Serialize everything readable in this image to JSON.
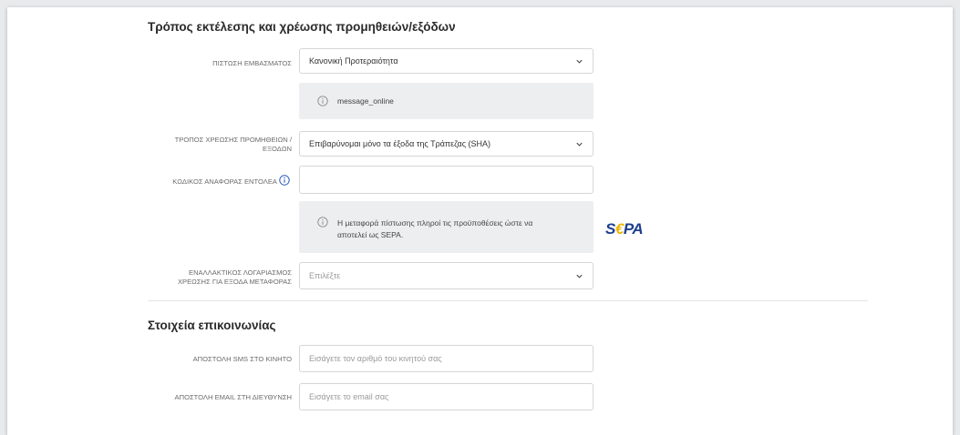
{
  "section1": {
    "title": "Τρόπος εκτέλεσης και χρέωσης προμηθειών/εξόδων",
    "credit_label": "ΠΙΣΤΩΣΗ ΕΜΒΑΣΜΑΤΟΣ",
    "credit_value": "Κανονική Προτεραιότητα",
    "message_online": "message_online",
    "charge_label_line1": "ΤΡΟΠΟΣ ΧΡΕΩΣΗΣ ΠΡΟΜΗΘΕΙΩΝ /",
    "charge_label_line2": "ΕΞΟΔΩΝ",
    "charge_value": "Επιβαρύνομαι μόνο τα έξοδα της Τράπεζας (SHA)",
    "reference_label": "ΚΩΔΙΚΟΣ ΑΝΑΦΟΡΑΣ ΕΝΤΟΛΕΑ",
    "reference_value": "",
    "sepa_message_line1": "Η μεταφορά πίστωσης πληροί τις προϋποθέσεις ώστε να",
    "sepa_message_line2": "αποτελεί ως SEPA.",
    "sepa_logo_text": "SEPA",
    "alt_account_label_line1": "ΕΝΑΛΛΑΚΤΙΚΟΣ ΛΟΓΑΡΙΑΣΜΟΣ",
    "alt_account_label_line2": "ΧΡΕΩΣΗΣ ΓΙΑ ΕΞΟΔΑ ΜΕΤΑΦΟΡΑΣ",
    "alt_account_placeholder": "Επιλέξτε"
  },
  "section2": {
    "title": "Στοιχεία επικοινωνίας",
    "sms_label": "ΑΠΟΣΤΟΛΗ SMS ΣΤΟ ΚΙΝΗΤΟ",
    "sms_placeholder": "Εισάγετε τον αριθμό του κινητού σας",
    "email_label": "ΑΠΟΣΤΟΛΗ EMAIL ΣΤΗ ΔΙΕΥΘΥΝΣΗ",
    "email_placeholder": "Εισάγετε το email σας"
  },
  "icons": {
    "chevron": "chevron-down-icon",
    "info": "info-icon"
  },
  "colors": {
    "accent": "#2a5dbd",
    "message_bg": "#eceef0",
    "sepa_blue": "#1d3f8f",
    "sepa_yellow": "#f0b400"
  }
}
